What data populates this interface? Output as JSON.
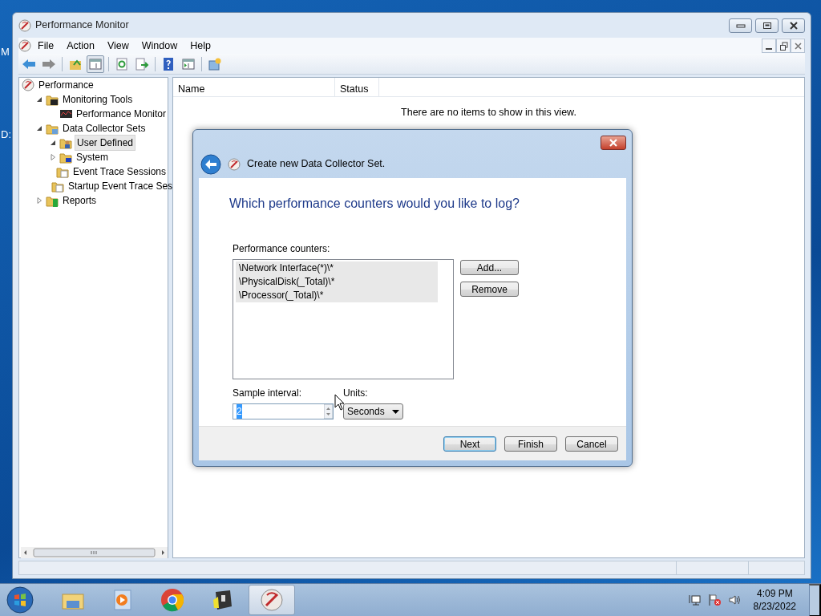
{
  "desktop_labels": [
    "M",
    "D:"
  ],
  "window": {
    "title": "Performance Monitor",
    "menu": [
      "File",
      "Action",
      "View",
      "Window",
      "Help"
    ],
    "toolbar": [
      {
        "kind": "back",
        "pressed": false
      },
      {
        "kind": "forward",
        "pressed": false
      },
      {
        "kind": "sep"
      },
      {
        "kind": "up",
        "pressed": false
      },
      {
        "kind": "tree",
        "pressed": true
      },
      {
        "kind": "sep"
      },
      {
        "kind": "refresh",
        "pressed": false
      },
      {
        "kind": "export",
        "pressed": false
      },
      {
        "kind": "sep"
      },
      {
        "kind": "help",
        "pressed": false
      },
      {
        "kind": "pane",
        "pressed": false
      },
      {
        "kind": "sep"
      },
      {
        "kind": "newwin",
        "pressed": false
      }
    ],
    "tree": [
      {
        "label": "Performance",
        "kind": "gauge",
        "selected": false,
        "children": [
          {
            "label": "Monitoring Tools",
            "kind": "folder-tools",
            "expanded": true,
            "selected": false,
            "children": [
              {
                "label": "Performance Monitor",
                "kind": "monitor",
                "selected": false
              }
            ]
          },
          {
            "label": "Data Collector Sets",
            "kind": "folder-sets",
            "expanded": true,
            "selected": false,
            "children": [
              {
                "label": "User Defined",
                "kind": "folder-user",
                "expanded": true,
                "selected": true
              },
              {
                "label": "System",
                "kind": "folder-system",
                "expanded": false,
                "selected": false
              },
              {
                "label": "Event Trace Sessions",
                "kind": "folder-trace",
                "selected": false
              },
              {
                "label": "Startup Event Trace Ses",
                "kind": "folder-trace",
                "selected": false
              }
            ]
          },
          {
            "label": "Reports",
            "kind": "folder-reports",
            "expanded": false,
            "selected": false
          }
        ]
      }
    ],
    "list": {
      "columns": [
        "Name",
        "Status"
      ],
      "empty_message": "There are no items to show in this view."
    }
  },
  "dialog": {
    "title": "Create new Data Collector Set.",
    "heading": "Which performance counters would you like to log?",
    "counters_label": "Performance counters:",
    "counters": [
      {
        "text": "\\Network Interface(*)\\*",
        "selected": true
      },
      {
        "text": "\\PhysicalDisk(_Total)\\*",
        "selected": true
      },
      {
        "text": "\\Processor(_Total)\\*",
        "selected": true
      }
    ],
    "side_buttons": [
      "Add...",
      "Remove"
    ],
    "sample_interval": {
      "label": "Sample interval:",
      "value": "2"
    },
    "units": {
      "label": "Units:",
      "value": "Seconds"
    },
    "footer_buttons": [
      {
        "label": "Next",
        "default": true
      },
      {
        "label": "Finish",
        "default": false
      },
      {
        "label": "Cancel",
        "default": false
      }
    ]
  },
  "taskbar": {
    "apps": [
      {
        "kind": "explorer",
        "active": false
      },
      {
        "kind": "media",
        "active": false
      },
      {
        "kind": "chrome",
        "active": false
      },
      {
        "kind": "tool",
        "active": false
      },
      {
        "kind": "perfmon",
        "active": true
      }
    ],
    "time": "4:09 PM",
    "date": "8/23/2022"
  }
}
